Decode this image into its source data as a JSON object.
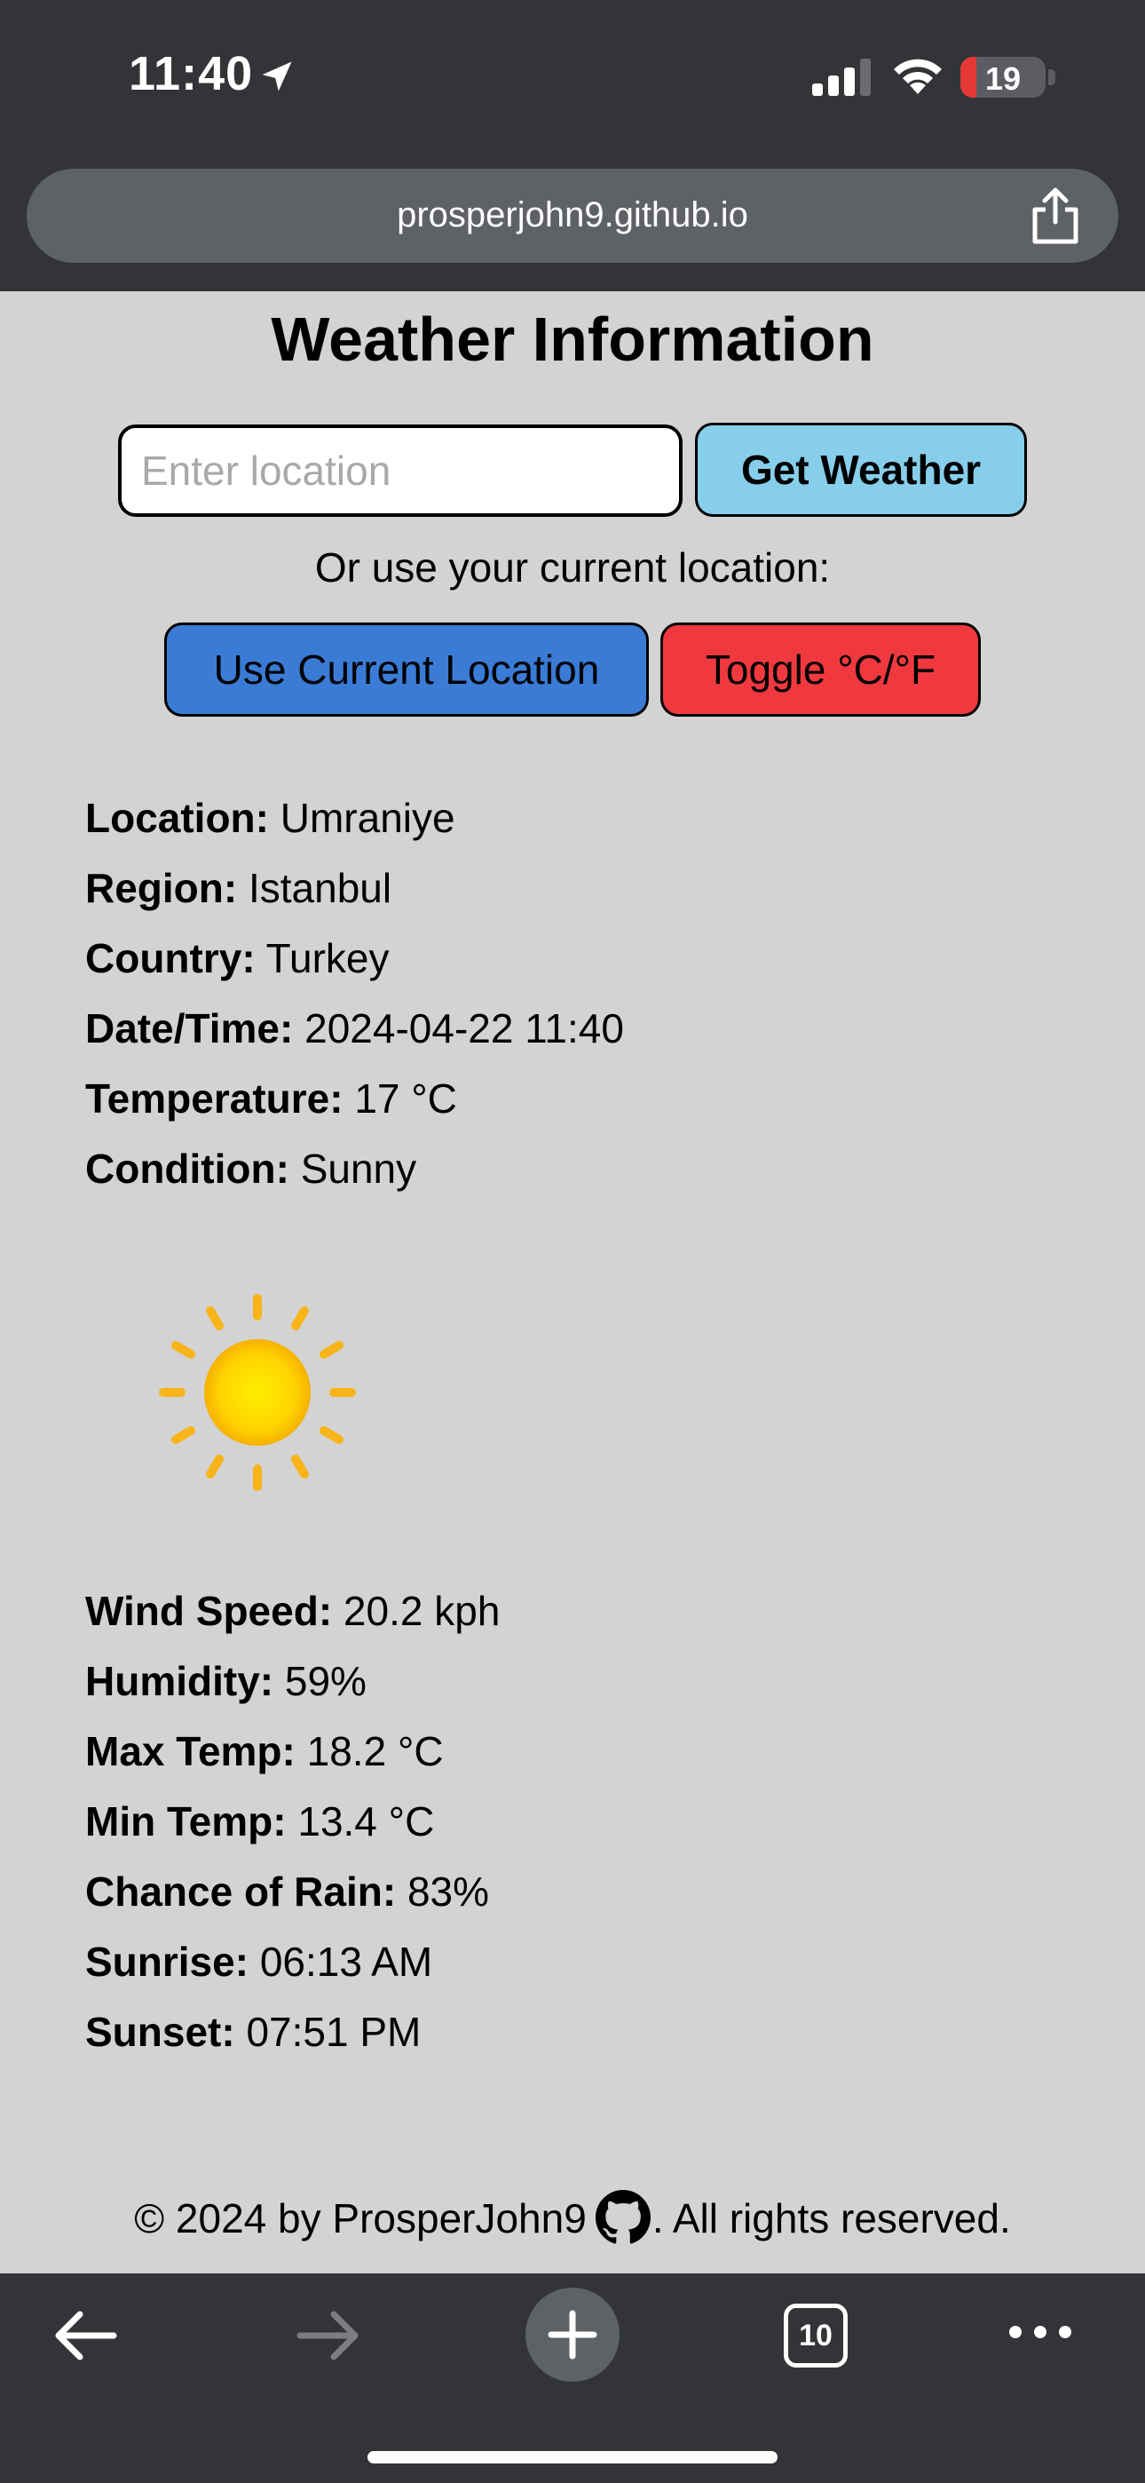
{
  "status_bar": {
    "time": "11:40",
    "battery_level": "19",
    "battery_fraction": 0.19
  },
  "browser": {
    "url": "prosperjohn9.github.io",
    "tab_count": "10"
  },
  "header": {
    "title": "Weather Information"
  },
  "search": {
    "placeholder": "Enter location",
    "value": "",
    "button_label": "Get Weather",
    "or_text": "Or use your current location:",
    "current_location_label": "Use Current Location",
    "toggle_label": "Toggle °C/°F"
  },
  "weather": {
    "location": {
      "label": "Location:",
      "value": "Umraniye"
    },
    "region": {
      "label": "Region:",
      "value": "Istanbul"
    },
    "country": {
      "label": "Country:",
      "value": "Turkey"
    },
    "datetime": {
      "label": "Date/Time:",
      "value": "2024-04-22 11:40"
    },
    "temperature": {
      "label": "Temperature:",
      "value": "17 °C"
    },
    "condition": {
      "label": "Condition:",
      "value": "Sunny"
    },
    "condition_icon": "sun-icon",
    "wind": {
      "label": "Wind Speed:",
      "value": "20.2 kph"
    },
    "humidity": {
      "label": "Humidity:",
      "value": "59%"
    },
    "max_temp": {
      "label": "Max Temp:",
      "value": "18.2 °C"
    },
    "min_temp": {
      "label": "Min Temp:",
      "value": "13.4 °C"
    },
    "rain": {
      "label": "Chance of Rain:",
      "value": "83%"
    },
    "sunrise": {
      "label": "Sunrise:",
      "value": "06:13 AM"
    },
    "sunset": {
      "label": "Sunset:",
      "value": "07:51 PM"
    }
  },
  "footer": {
    "prefix": "© 2024 by ProsperJohn9",
    "suffix": ". All rights reserved.",
    "icon": "github-icon"
  },
  "colors": {
    "page_bg": "#d3d3d3",
    "chrome_bg": "#323438",
    "get_weather_btn": "#87ceeb",
    "current_location_btn": "#3a7bd5",
    "toggle_btn": "#f0393f",
    "battery_low": "#e43935"
  }
}
